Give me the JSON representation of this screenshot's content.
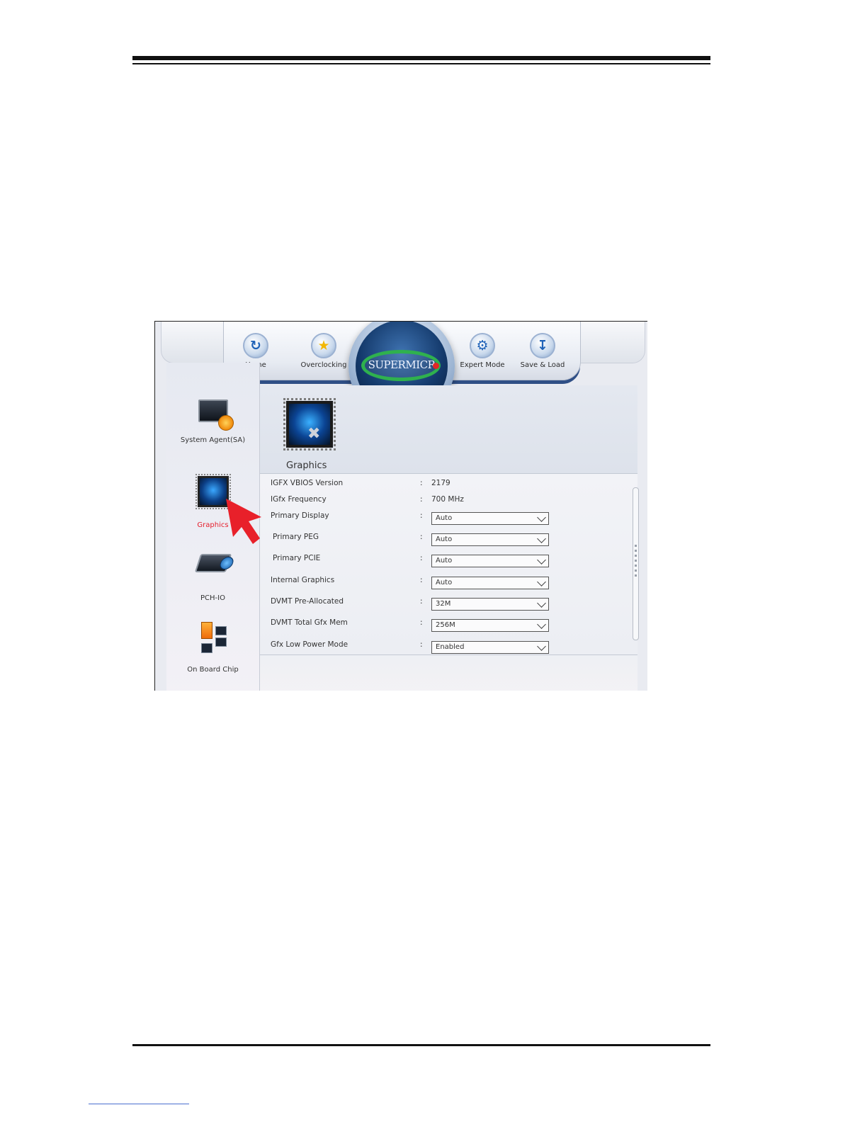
{
  "bios": {
    "top_menu": [
      {
        "label": "Home",
        "icon": "refresh-icon"
      },
      {
        "label": "Overclocking",
        "icon": "star-icon"
      },
      {
        "label": "Expert Mode",
        "icon": "gear-icon"
      },
      {
        "label": "Save & Load",
        "icon": "download-icon"
      }
    ],
    "logo_text": "SUPERMICR",
    "sidebar": [
      {
        "label": "System Agent(SA)",
        "icon": "system-agent-icon"
      },
      {
        "label": "Graphics",
        "icon": "graphics-icon",
        "active": true
      },
      {
        "label": "PCH-IO",
        "icon": "pch-io-icon"
      },
      {
        "label": "On Board Chip",
        "icon": "onboard-chip-icon"
      }
    ],
    "page_title": "Graphics",
    "settings": [
      {
        "name": "IGFX VBIOS Version",
        "value": "2179",
        "type": "text"
      },
      {
        "name": "IGfx Frequency",
        "value": "700 MHz",
        "type": "text"
      },
      {
        "name": "Primary Display",
        "value": "Auto",
        "type": "select"
      },
      {
        "name": "Primary PEG",
        "value": "Auto",
        "type": "select"
      },
      {
        "name": "Primary PCIE",
        "value": "Auto",
        "type": "select"
      },
      {
        "name": "Internal Graphics",
        "value": "Auto",
        "type": "select"
      },
      {
        "name": "DVMT Pre-Allocated",
        "value": "32M",
        "type": "select"
      },
      {
        "name": "DVMT Total Gfx Mem",
        "value": "256M",
        "type": "select"
      },
      {
        "name": "Gfx Low Power Mode",
        "value": "Enabled",
        "type": "select"
      }
    ],
    "separator": ":",
    "colors": {
      "active_label": "#e5202e",
      "arrow": "#e8202a",
      "accent": "#2f4f86"
    }
  }
}
